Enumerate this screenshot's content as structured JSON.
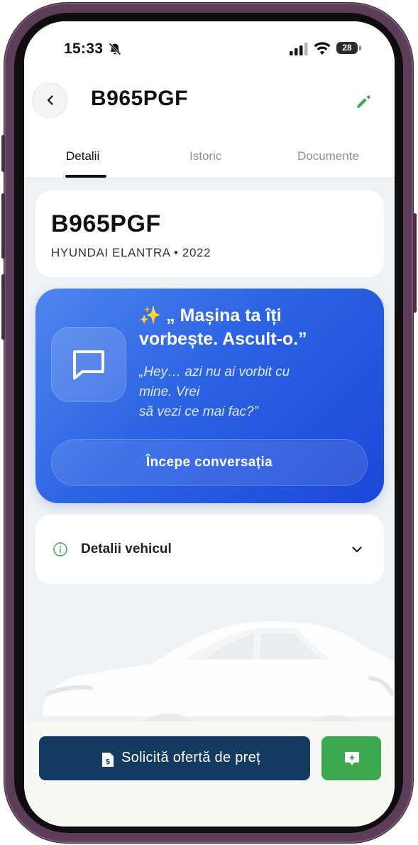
{
  "status_bar": {
    "time": "15:33",
    "battery": "28"
  },
  "header": {
    "title": "B965PGF"
  },
  "tabs": [
    {
      "label": "Detalii",
      "active": true
    },
    {
      "label": "Istoric",
      "active": false
    },
    {
      "label": "Documente",
      "active": false
    }
  ],
  "vehicle": {
    "plate": "B965PGF",
    "model_line": "HYUNDAI ELANTRA • 2022"
  },
  "ai_card": {
    "title_line1": "✨ „ Mașina ta îți",
    "title_line2": "vorbește. Ascult-o.”",
    "quote_line1": "„Hey… azi nu ai vorbit cu",
    "quote_line2": "mine. Vrei",
    "quote_line3": "să vezi ce mai fac?”",
    "cta": "Începe conversația"
  },
  "details_section": {
    "label": "Detalii vehicul"
  },
  "bottom": {
    "quote_button": "Solicită ofertă de preț"
  },
  "colors": {
    "accent_blue": "#2c63e4",
    "navy": "#123a63",
    "green": "#3ea84f"
  }
}
